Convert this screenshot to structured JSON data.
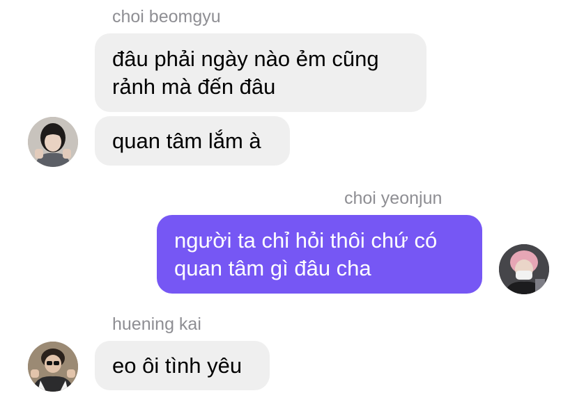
{
  "messages": [
    {
      "sender": "choi beomgyu",
      "bubbles": [
        "đâu phải ngày nào ẻm cũng rảnh mà đến đâu",
        "quan tâm lắm à"
      ]
    },
    {
      "sender": "choi yeonjun",
      "bubbles": [
        "người ta chỉ hỏi thôi chứ có quan tâm gì đâu cha"
      ]
    },
    {
      "sender": "huening kai",
      "bubbles": [
        "eo ôi tình yêu"
      ]
    }
  ],
  "colors": {
    "incoming_bubble": "#efefef",
    "outgoing_bubble": "#7657f4",
    "sender_name": "#8e8e93"
  },
  "icons": {
    "avatar_beomgyu": "avatar-photo",
    "avatar_yeonjun": "avatar-photo",
    "avatar_kai": "avatar-photo"
  }
}
